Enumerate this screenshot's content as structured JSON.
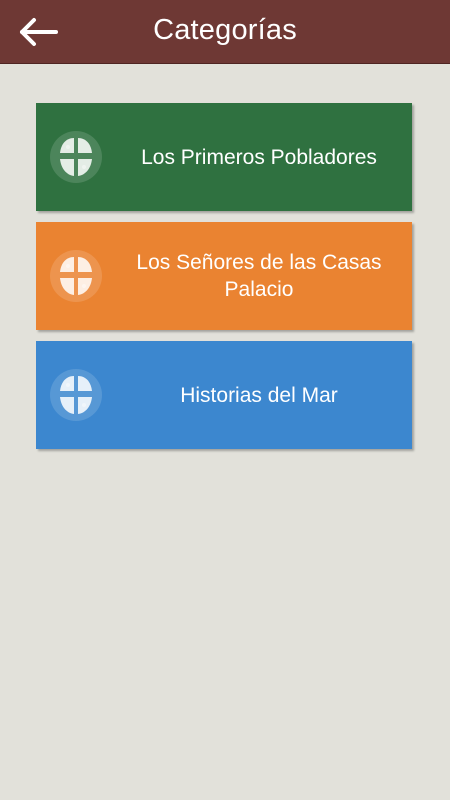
{
  "header": {
    "title": "Categorías",
    "back_icon": "arrow-left-icon"
  },
  "categories": [
    {
      "label": "Los Primeros Pobladores",
      "color": "#2f7140",
      "icon": "cross-emblem-icon"
    },
    {
      "label": "Los Señores de las Casas Palacio",
      "color": "#ea8331",
      "icon": "cross-emblem-icon"
    },
    {
      "label": "Historias del Mar",
      "color": "#3c87cf",
      "icon": "cross-emblem-icon"
    }
  ]
}
